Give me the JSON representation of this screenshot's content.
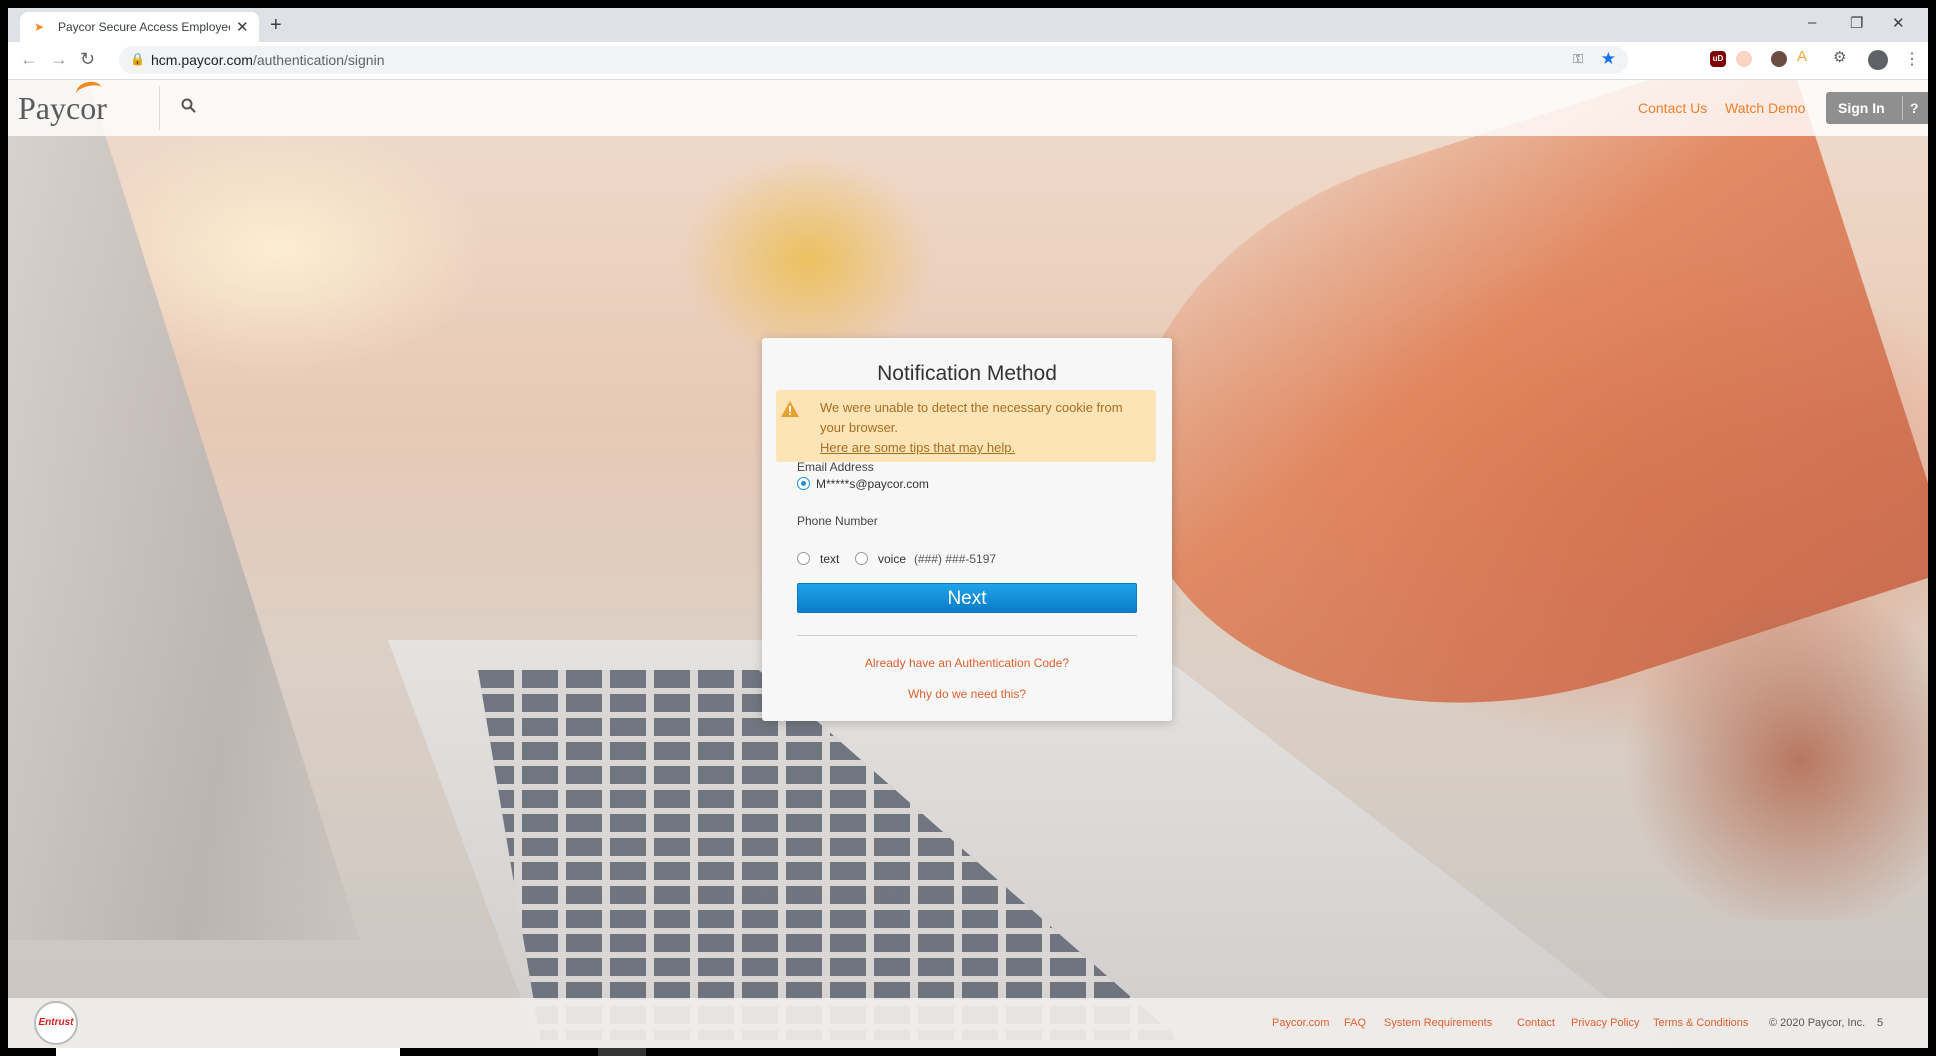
{
  "browser": {
    "tab_title": "Paycor Secure Access Employee",
    "url_host": "hcm.paycor.com",
    "url_path": "/authentication/signin",
    "new_tab_label": "+",
    "minimize_label": "–",
    "restore_label": "❐",
    "close_label": "✕",
    "tab_close_label": "✕",
    "ublock_label": "uD"
  },
  "header": {
    "logo_text": "Paycor",
    "contact_us": "Contact Us",
    "watch_demo": "Watch Demo",
    "sign_in": "Sign In",
    "help": "?"
  },
  "modal": {
    "title": "Notification Method",
    "alert_line1": "We were unable to detect the necessary cookie from your browser.",
    "alert_link": "Here are some tips that may help.",
    "email_label": "Email Address",
    "email_value": "M*****s@paycor.com",
    "phone_label": "Phone Number",
    "option_text": "text",
    "option_voice": "voice",
    "phone_masked": "(###) ###-5197",
    "next_label": "Next",
    "auth_code_link": "Already have an Authentication Code?",
    "why_link": "Why do we need this?"
  },
  "footer": {
    "seal_text": "Entrust",
    "links": [
      "Paycor.com",
      "FAQ",
      "System Requirements",
      "Contact",
      "Privacy Policy",
      "Terms & Conditions"
    ],
    "copyright": "© 2020 Paycor, Inc.",
    "page_number": "5"
  },
  "colors": {
    "brand_orange": "#f07f2a",
    "link_red": "#e06030",
    "next_blue": "#1a8fde",
    "alert_bg": "#fde4b6"
  }
}
